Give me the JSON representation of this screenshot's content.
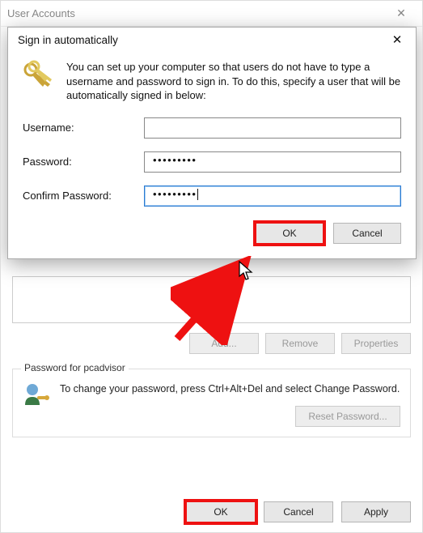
{
  "parent": {
    "title": "User Accounts",
    "add_btn": "Add...",
    "remove_btn": "Remove",
    "properties_btn": "Properties",
    "group_title": "Password for pcadvisor",
    "group_text": "To change your password, press Ctrl+Alt+Del and select Change Password.",
    "reset_btn": "Reset Password...",
    "ok_btn": "OK",
    "cancel_btn": "Cancel",
    "apply_btn": "Apply"
  },
  "modal": {
    "title": "Sign in automatically",
    "intro": "You can set up your computer so that users do not have to type a username and password to sign in. To do this, specify a user that will be automatically signed in below:",
    "username_label": "Username:",
    "password_label": "Password:",
    "confirm_label": "Confirm Password:",
    "username_value": "",
    "password_value": "•••••••••",
    "confirm_value": "•••••••••",
    "ok_btn": "OK",
    "cancel_btn": "Cancel"
  }
}
